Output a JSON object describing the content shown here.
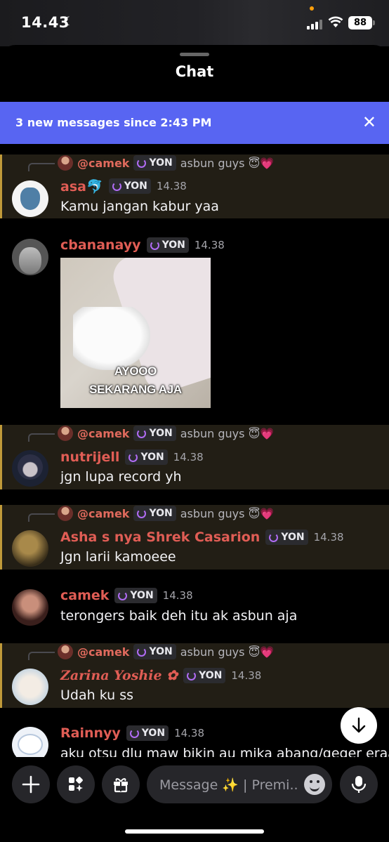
{
  "status_bar": {
    "time": "14.43",
    "battery": "88"
  },
  "header": {
    "title": "Chat"
  },
  "banner": {
    "text": "3 new messages since 2:43 PM",
    "close": "✕"
  },
  "role_tag": "YON",
  "messages": [
    {
      "reply_to": "@camek",
      "reply_text": "asbun guys 😇💗",
      "author": "asa🐬",
      "time": "14.38",
      "text": "Kamu jangan kabur yaa"
    },
    {
      "author": "cbananayy",
      "time": "14.38",
      "image_caption_line1": "AYOOO",
      "image_caption_line2": "SEKARANG AJA"
    },
    {
      "reply_to": "@camek",
      "reply_text": "asbun guys 😇💗",
      "author": "nutrijell",
      "time": "14.38",
      "text": "jgn lupa record yh"
    },
    {
      "reply_to": "@camek",
      "reply_text": "asbun guys 😇💗",
      "author": "Asha s nya Shrek Casarion",
      "time": "14.38",
      "text": "Jgn larii kamoeee"
    },
    {
      "author": "camek",
      "time": "14.38",
      "text": "terongers baik deh itu ak asbun aja"
    },
    {
      "reply_to": "@camek",
      "reply_text": "asbun guys 😇💗",
      "author": "Zarina Yoshie ✿",
      "time": "14.38",
      "text": "Udah ku ss"
    },
    {
      "author": "Rainnyy",
      "time": "14.38",
      "text": "aku otsu dlu maw bikin au mika abang/geger eraa"
    }
  ],
  "composer": {
    "placeholder": "Message ✨ | Premi.."
  },
  "icons": {
    "add": "plus-icon",
    "apps": "apps-icon",
    "gift": "gift-icon",
    "emoji": "emoji-icon",
    "mic": "microphone-icon",
    "scroll_down": "arrow-down-icon"
  }
}
